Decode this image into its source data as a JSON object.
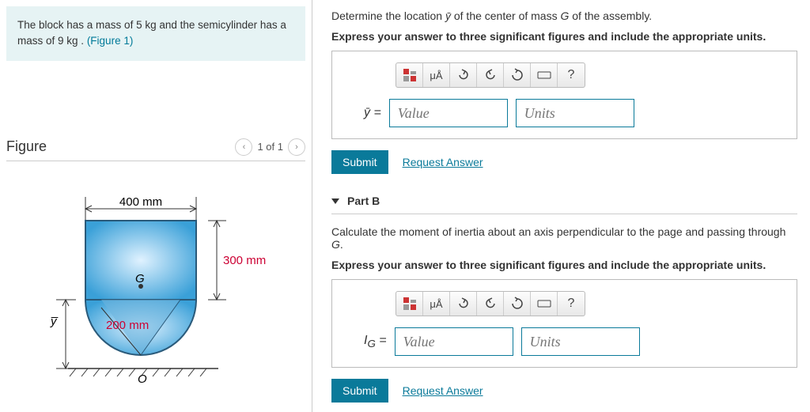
{
  "problem": {
    "text_before": "The block has a mass of 5  ",
    "unit1": "kg",
    "text_mid": " and the semicylinder has a mass of 9  ",
    "unit2": "kg",
    "text_after": " . ",
    "figlink": "(Figure 1)"
  },
  "figure": {
    "heading": "Figure",
    "counter": "1 of 1",
    "dim_top": "400 mm",
    "dim_side": "300 mm",
    "dim_radius": "200 mm",
    "label_G": "G",
    "label_ybar": "y",
    "label_O": "O"
  },
  "partA": {
    "prompt_pre": "Determine the location ",
    "var": "ȳ",
    "prompt_mid": " of the center of mass ",
    "gvar": "G",
    "prompt_post": " of the assembly.",
    "instr": "Express your answer to three significant figures and include the appropriate units.",
    "label": "ȳ =",
    "value_placeholder": "Value",
    "units_placeholder": "Units",
    "submit": "Submit",
    "request": "Request Answer"
  },
  "partB": {
    "title": "Part B",
    "prompt_pre": "Calculate the moment of inertia about an axis perpendicular to the page and passing through ",
    "gvar": "G",
    "prompt_post": ".",
    "instr": "Express your answer to three significant figures and include the appropriate units.",
    "label": "I",
    "sub": "G",
    "eq": " =",
    "value_placeholder": "Value",
    "units_placeholder": "Units",
    "submit": "Submit",
    "request": "Request Answer"
  },
  "toolbar": {
    "ua": "μÅ",
    "q": "?"
  }
}
